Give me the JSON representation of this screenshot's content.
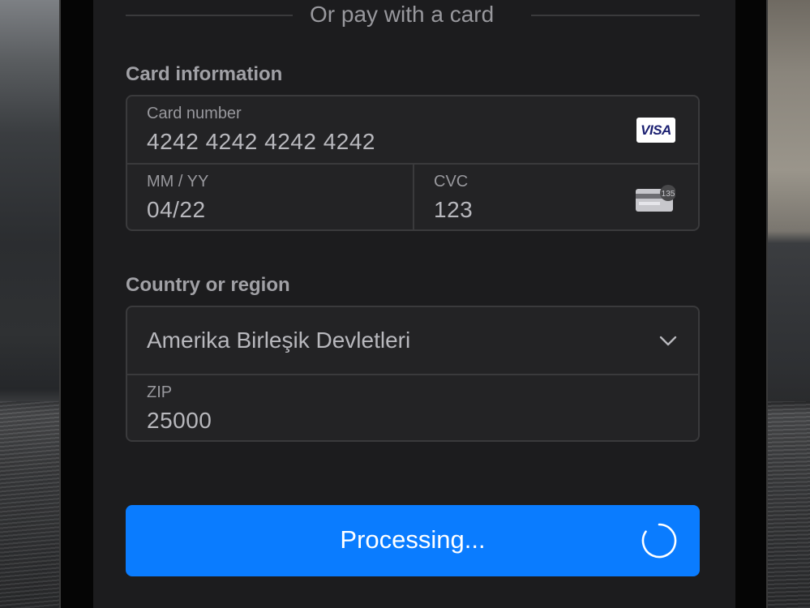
{
  "divider": {
    "text": "Or pay with a card"
  },
  "card_section": {
    "heading": "Card information",
    "card_number": {
      "label": "Card number",
      "value": "4242 4242 4242 4242",
      "brand": "VISA"
    },
    "expiry": {
      "label": "MM / YY",
      "value": "04/22"
    },
    "cvc": {
      "label": "CVC",
      "value": "123",
      "icon_text": "135"
    }
  },
  "country_section": {
    "heading": "Country or region",
    "country": {
      "value": "Amerika Birleşik Devletleri"
    },
    "zip": {
      "label": "ZIP",
      "value": "25000"
    }
  },
  "pay_button": {
    "label": "Processing..."
  },
  "colors": {
    "accent": "#0a7cff",
    "background": "#1c1c1e",
    "field_border": "#3a3a3c",
    "text_muted": "#98989d"
  },
  "icons": [
    "visa-icon",
    "card-cvc-icon",
    "chevron-down-icon",
    "spinner-icon"
  ]
}
